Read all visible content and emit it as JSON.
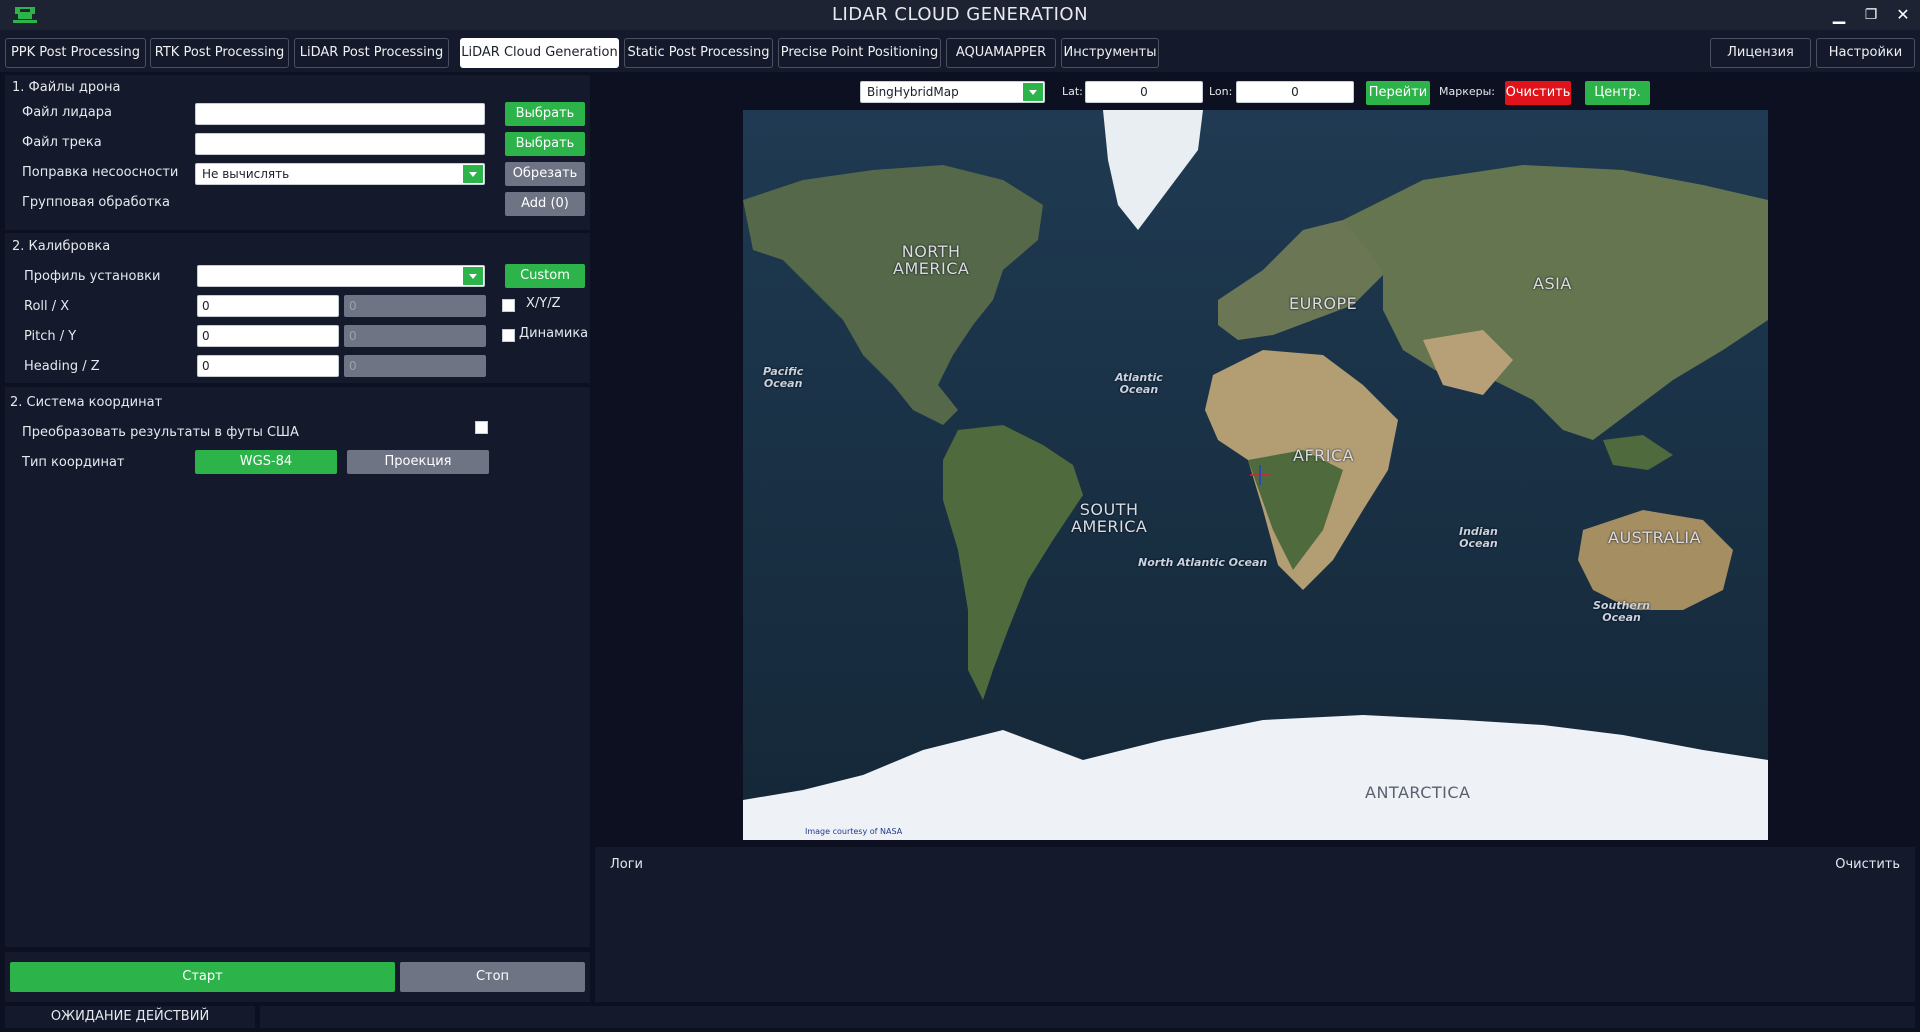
{
  "window": {
    "title": "LIDAR CLOUD GENERATION",
    "minimize": "▁",
    "restore": "❐",
    "close": "✕"
  },
  "tabs": [
    {
      "label": "PPK Post Processing"
    },
    {
      "label": "RTK Post Processing"
    },
    {
      "label": "LiDAR Post Processing"
    },
    {
      "label": "LiDAR Cloud Generation",
      "active": true
    },
    {
      "label": "Static Post Processing"
    },
    {
      "label": "Precise Point Positioning"
    },
    {
      "label": "AQUAMAPPER"
    },
    {
      "label": "Инструменты"
    }
  ],
  "right_tabs": {
    "license": "Лицензия",
    "settings": "Настройки"
  },
  "drone_files": {
    "title": "1. Файлы дрона",
    "lidar_file_label": "Файл лидара",
    "lidar_file_value": "",
    "track_file_label": "Файл трека",
    "track_file_value": "",
    "select_label": "Выбрать",
    "misalign_label": "Поправка несоосности",
    "misalign_value": "Не вычислять",
    "trim_label": "Обрезать",
    "group_label": "Групповая обработка",
    "add_label": "Add (0)"
  },
  "calibration": {
    "title": "2. Калибровка",
    "profile_label": "Профиль установки",
    "profile_value": "",
    "custom_label": "Custom",
    "roll_label": "Roll / X",
    "pitch_label": "Pitch / Y",
    "heading_label": "Heading / Z",
    "roll_value": "0",
    "roll_value2": "0",
    "pitch_value": "0",
    "pitch_value2": "0",
    "heading_value": "0",
    "heading_value2": "0",
    "xyz_label": "X/Y/Z",
    "xyz_checked": false,
    "dynamics_label": "Динамика",
    "dynamics_checked": false
  },
  "coordinates": {
    "title": "2. Система координат",
    "us_feet_label": "Преобразовать результаты в футы США",
    "us_feet_checked": false,
    "coord_type_label": "Тип координат",
    "wgs84_label": "WGS-84",
    "projection_label": "Проекция"
  },
  "actions": {
    "start": "Старт",
    "stop": "Стоп"
  },
  "map": {
    "provider": "BingHybridMap",
    "lat_label": "Lat:",
    "lat_value": "0",
    "lon_label": "Lon:",
    "lon_value": "0",
    "go_label": "Перейти",
    "markers_label": "Маркеры:",
    "clear_label": "Очистить",
    "center_label": "Центр.",
    "credit": "Image courtesy of NASA",
    "labels": {
      "north_america_1": "NORTH",
      "north_america_2": "AMERICA",
      "europe": "EUROPE",
      "asia": "ASIA",
      "africa": "AFRICA",
      "south_america_1": "SOUTH",
      "south_america_2": "AMERICA",
      "australia": "AUSTRALIA",
      "antarctica": "ANTARCTICA",
      "pacific_1": "Pacific",
      "pacific_2": "Ocean",
      "atlantic_1": "Atlantic",
      "atlantic_2": "Ocean",
      "indian_1": "Indian",
      "indian_2": "Ocean",
      "south_atlantic": "North Atlantic Ocean",
      "southern_1": "Southern",
      "southern_2": "Ocean"
    },
    "colors": {
      "ocean": "#1b3347",
      "land": "#5a6e4a",
      "desert": "#b8a27a",
      "ice": "#eef2f6"
    }
  },
  "logs": {
    "title": "Логи",
    "clear_label": "Очистить"
  },
  "status": {
    "text": "ОЖИДАНИЕ ДЕЙСТВИЙ"
  }
}
